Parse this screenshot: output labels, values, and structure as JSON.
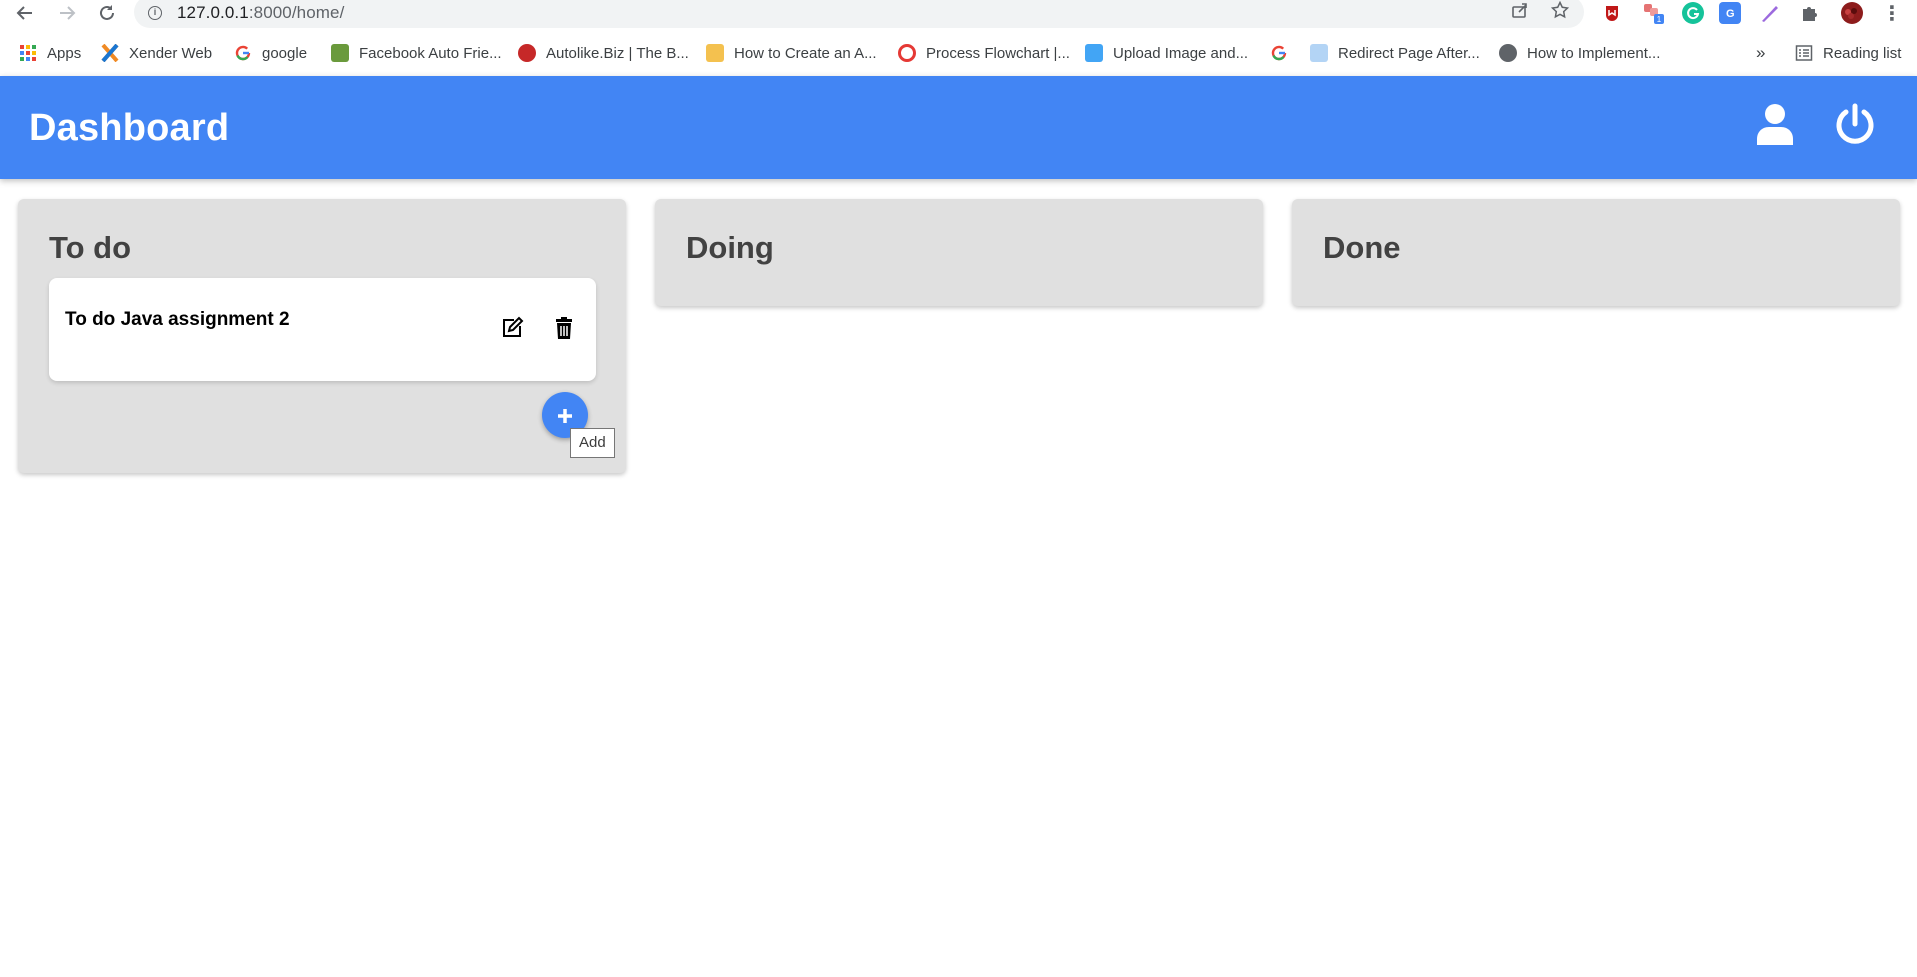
{
  "browser": {
    "url_host": "127.0.0.1",
    "url_path": ":8000/home/",
    "bookmarks": [
      {
        "label": "Apps",
        "icon": "apps-grid-icon"
      },
      {
        "label": "Xender Web",
        "icon": "xender-icon"
      },
      {
        "label": "google",
        "icon": "google-icon"
      },
      {
        "label": "Facebook Auto Frie...",
        "icon": "bookmark-favicon"
      },
      {
        "label": "Autolike.Biz | The B...",
        "icon": "bookmark-favicon"
      },
      {
        "label": "How to Create an A...",
        "icon": "bookmark-favicon"
      },
      {
        "label": "Process Flowchart |...",
        "icon": "bookmark-favicon"
      },
      {
        "label": "Upload Image and...",
        "icon": "bookmark-favicon"
      },
      {
        "label": "",
        "icon": "google-icon"
      },
      {
        "label": "Redirect Page After...",
        "icon": "bookmark-favicon"
      },
      {
        "label": "How to Implement...",
        "icon": "globe-icon"
      }
    ],
    "overflow": "»",
    "reading_list": "Reading list",
    "extension_badge": "1"
  },
  "app": {
    "title": "Dashboard",
    "accent_color": "#4285f4",
    "header_icons": [
      "user-icon",
      "power-icon"
    ]
  },
  "board": {
    "columns": [
      {
        "title": "To do",
        "tasks": [
          {
            "text": "To do Java assignment 2"
          }
        ],
        "add_tooltip": "Add"
      },
      {
        "title": "Doing",
        "tasks": []
      },
      {
        "title": "Done",
        "tasks": []
      }
    ]
  }
}
